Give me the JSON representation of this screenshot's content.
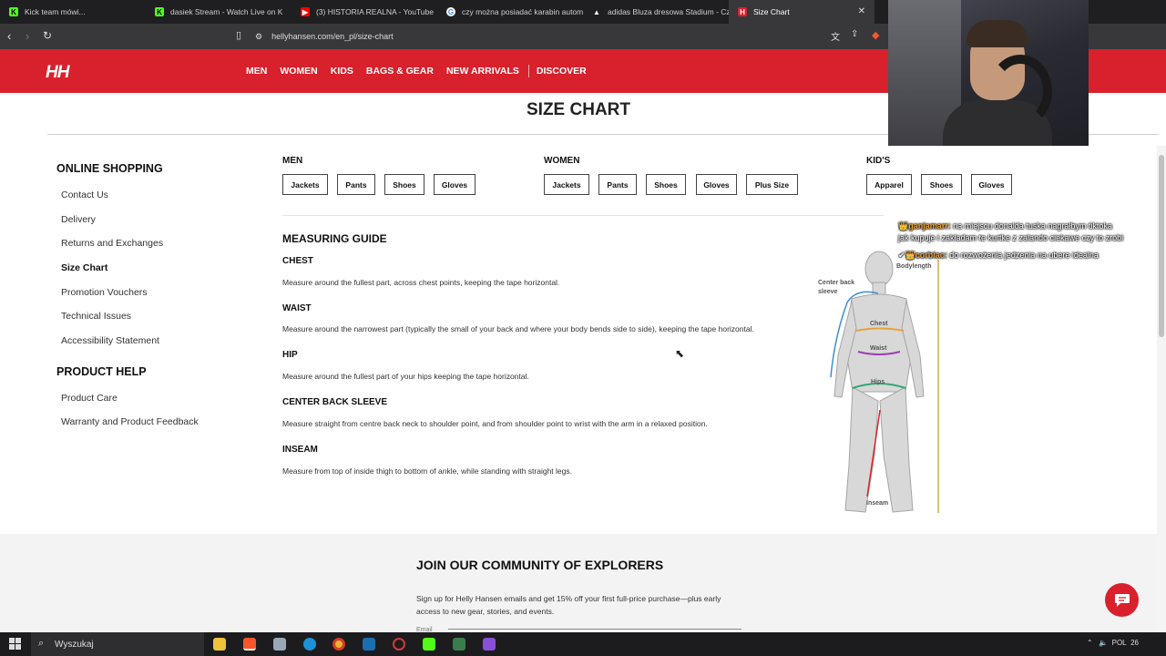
{
  "browser": {
    "tabs": [
      {
        "label": "Kick team mówi...",
        "icon": "kick-icon",
        "color": "#53fc18",
        "active": false
      },
      {
        "label": "dasiek Stream - Watch Live on K",
        "icon": "kick-icon",
        "color": "#53fc18",
        "active": false
      },
      {
        "label": "(3) HISTORIA REALNA - YouTube",
        "icon": "youtube-icon",
        "color": "#ff0000",
        "active": false
      },
      {
        "label": "czy można posiadać karabin autom",
        "icon": "google-icon",
        "color": "#4285f4",
        "active": false
      },
      {
        "label": "adidas Bluza dresowa Stadium - Cz",
        "icon": "adidas-icon",
        "color": "#ffffff",
        "active": false
      },
      {
        "label": "Size Chart",
        "icon": "hh-icon",
        "color": "#d8212c",
        "active": true
      }
    ],
    "url": "hellyhansen.com/en_pl/size-chart"
  },
  "site": {
    "logo": "HH",
    "brand_color": "#d8212c",
    "nav": [
      "MEN",
      "WOMEN",
      "KIDS",
      "BAGS & GEAR",
      "NEW ARRIVALS",
      "DISCOVER"
    ]
  },
  "page": {
    "title": "SIZE CHART"
  },
  "sidebar": {
    "online_shopping": {
      "heading": "ONLINE SHOPPING",
      "items": [
        "Contact Us",
        "Delivery",
        "Returns and Exchanges",
        "Size Chart",
        "Promotion Vouchers",
        "Technical Issues",
        "Accessibility Statement"
      ],
      "active_index": 3
    },
    "product_help": {
      "heading": "PRODUCT HELP",
      "items": [
        "Product Care",
        "Warranty and Product Feedback"
      ]
    }
  },
  "groups": {
    "men": {
      "heading": "MEN",
      "chips": [
        "Jackets",
        "Pants",
        "Shoes",
        "Gloves"
      ]
    },
    "women": {
      "heading": "WOMEN",
      "chips": [
        "Jackets",
        "Pants",
        "Shoes",
        "Gloves",
        "Plus Size"
      ]
    },
    "kids": {
      "heading": "KID'S",
      "chips": [
        "Apparel",
        "Shoes",
        "Gloves"
      ]
    }
  },
  "guide": {
    "title": "MEASURING GUIDE",
    "items": [
      {
        "heading": "CHEST",
        "text": "Measure around the fullest part, across chest points, keeping the tape horizontal."
      },
      {
        "heading": "WAIST",
        "text": "Measure around the narrowest part (typically the small of your back and where your body bends side to side), keeping the tape horizontal."
      },
      {
        "heading": "HIP",
        "text": "Measure around the fullest part of your hips keeping the tape horizontal."
      },
      {
        "heading": "CENTER BACK SLEEVE",
        "text": "Measure straight from centre back neck to shoulder point, and from shoulder point to wrist with the arm in a relaxed position."
      },
      {
        "heading": "INSEAM",
        "text": "Measure from top of inside thigh to bottom of ankle, while standing with straight legs."
      }
    ]
  },
  "figure": {
    "labels": {
      "sleeve1": "Center back",
      "sleeve2": "sleeve",
      "chest": "Chest",
      "waist": "Waist",
      "hips": "Hips",
      "inseam": "Inseam",
      "bodylength": "Bodylength"
    },
    "colors": {
      "sleeve": "#3b8fd6",
      "chest": "#e8a23c",
      "waist": "#9b3fb0",
      "hips": "#2fa876",
      "inseam": "#d8212c",
      "bodylength": "#c9a227"
    }
  },
  "chat": [
    {
      "user": "ganjamarr:",
      "message": "na miejscu donalda tuska nagrałbym tiktoka"
    },
    {
      "user": "",
      "message": "jak kupuje i zakładam te kurtke z zalando ciekawe czy to zrobi"
    },
    {
      "user": "corbiac:",
      "message": "do rozwożenia jedzenia na ubere idealna"
    }
  ],
  "footer": {
    "title": "JOIN OUR COMMUNITY OF EXPLORERS",
    "text": "Sign up for Helly Hansen emails and get 15% off your first full-price purchase—plus early access to new gear, stories, and events.",
    "email_label": "Email"
  },
  "taskbar": {
    "search_placeholder": "Wyszukaj",
    "tray": "POL",
    "time": "26"
  }
}
